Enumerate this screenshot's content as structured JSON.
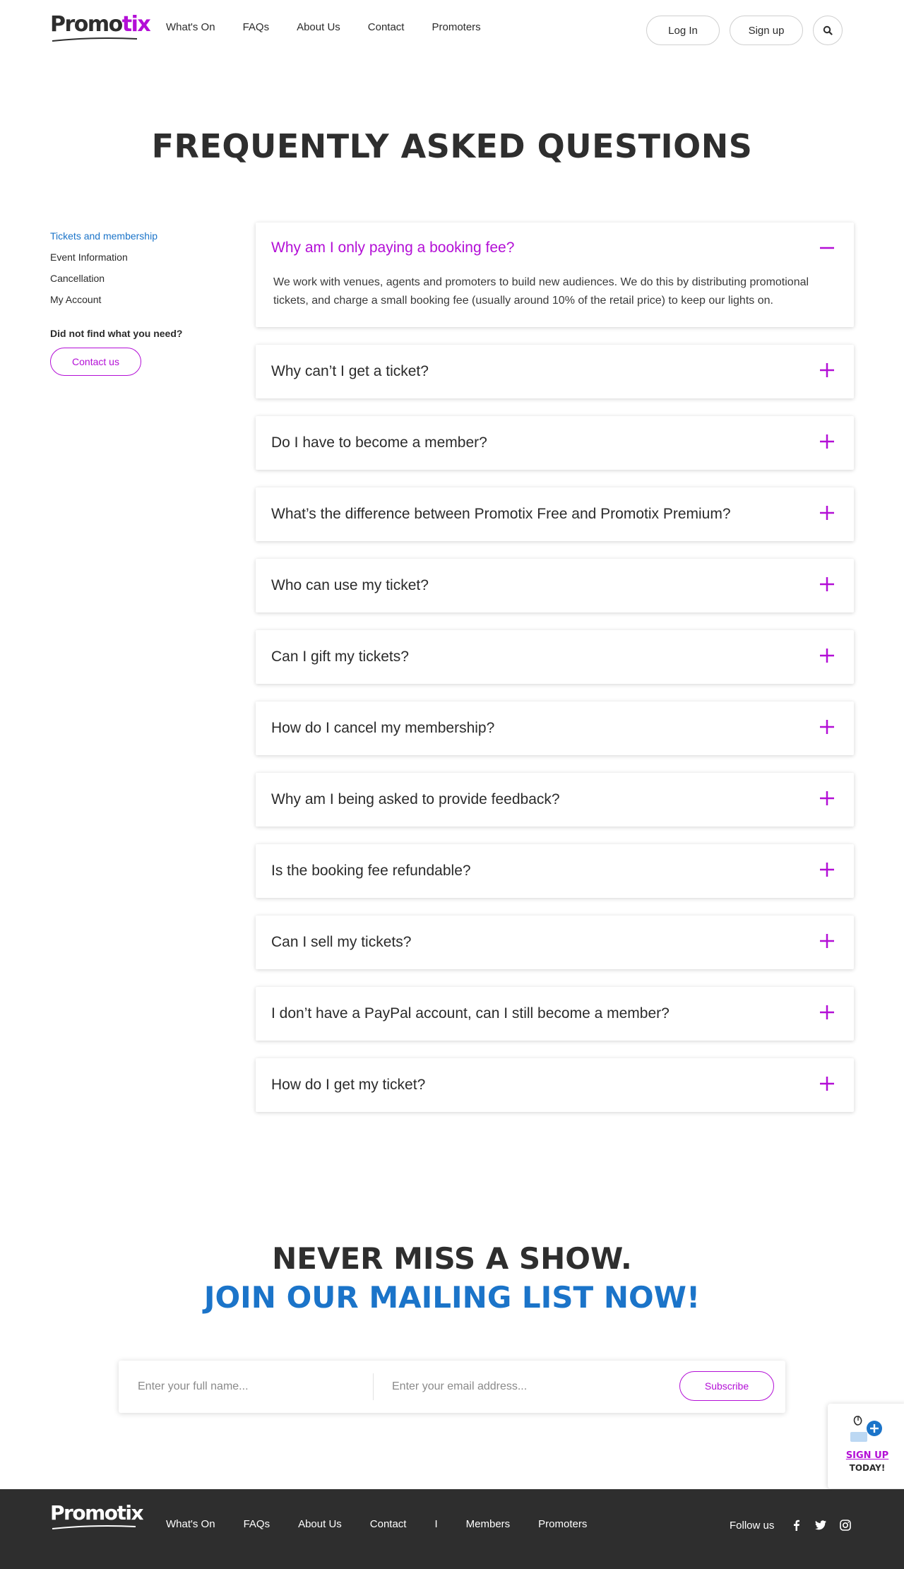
{
  "header": {
    "logo": {
      "part1": "Promo",
      "part2": "tix"
    },
    "nav": [
      "What's On",
      "FAQs",
      "About Us",
      "Contact",
      "Promoters"
    ],
    "login_label": "Log In",
    "signup_label": "Sign up",
    "search_icon": "search-icon"
  },
  "page": {
    "title": "FREQUENTLY ASKED QUESTIONS"
  },
  "sidebar": {
    "items": [
      {
        "label": "Tickets and membership",
        "active": true
      },
      {
        "label": "Event Information",
        "active": false
      },
      {
        "label": "Cancellation",
        "active": false
      },
      {
        "label": "My Account",
        "active": false
      }
    ],
    "help_text": "Did not find what you need?",
    "contact_label": "Contact us"
  },
  "faqs": [
    {
      "question": "Why am I only paying a booking fee?",
      "open": true,
      "answer": "We work with venues, agents and promoters to build new audiences. We do this by distributing promotional tickets, and charge a small booking fee (usually around 10% of the retail price) to keep our lights on."
    },
    {
      "question": "Why can’t I get a ticket?",
      "open": false
    },
    {
      "question": "Do I have to become a member?",
      "open": false
    },
    {
      "question": "What’s the difference between Promotix Free and Promotix Premium?",
      "open": false
    },
    {
      "question": "Who can use my ticket?",
      "open": false
    },
    {
      "question": "Can I gift my tickets?",
      "open": false
    },
    {
      "question": "How do I cancel my membership?",
      "open": false
    },
    {
      "question": "Why am I being asked to provide feedback?",
      "open": false
    },
    {
      "question": "Is the booking fee refundable?",
      "open": false
    },
    {
      "question": "Can I sell my tickets?",
      "open": false
    },
    {
      "question": "I don’t have a PayPal account, can I still become a member?",
      "open": false
    },
    {
      "question": "How do I get my ticket?",
      "open": false
    }
  ],
  "mailing": {
    "line1": "NEVER MISS A SHOW.",
    "line2": "JOIN OUR MAILING LIST NOW!",
    "name_placeholder": "Enter your full name...",
    "email_placeholder": "Enter your email address...",
    "subscribe_label": "Subscribe"
  },
  "signup_widget": {
    "line1": "SIGN UP",
    "line2": "TODAY!"
  },
  "footer": {
    "logo": "Promotix",
    "nav": [
      "What's On",
      "FAQs",
      "About Us",
      "Contact",
      "I",
      "Members",
      "Promoters"
    ],
    "follow_label": "Follow us",
    "social": [
      "facebook-icon",
      "twitter-icon",
      "instagram-icon"
    ]
  },
  "colors": {
    "accent": "#b30fd6",
    "link_blue": "#1b74c9",
    "footer_bg": "#2e2e2e",
    "text": "#2b2b2b"
  }
}
